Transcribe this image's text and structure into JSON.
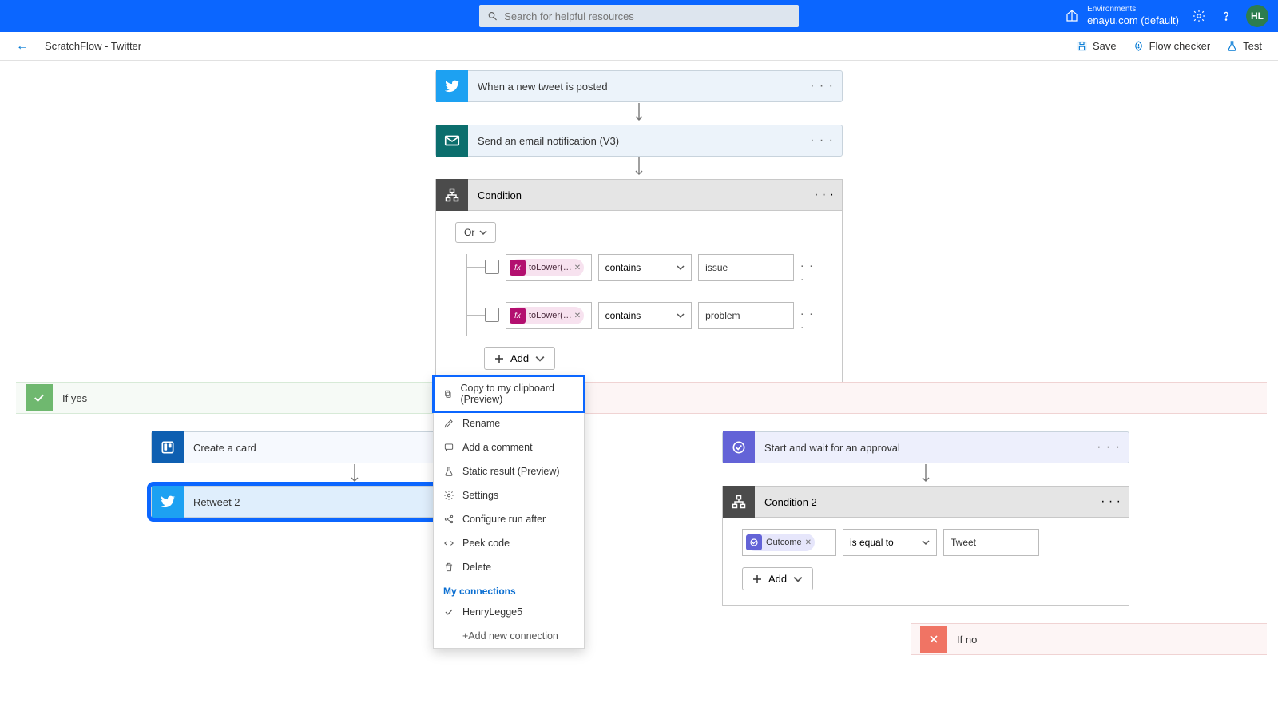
{
  "header": {
    "search_placeholder": "Search for helpful resources",
    "env_label": "Environments",
    "env_value": "enayu.com (default)",
    "avatar_initials": "HL"
  },
  "secbar": {
    "title": "ScratchFlow - Twitter",
    "save": "Save",
    "checker": "Flow checker",
    "test": "Test"
  },
  "steps": {
    "trigger": "When a new tweet is posted",
    "email": "Send an email notification (V3)",
    "condition": "Condition",
    "or_label": "Or",
    "rows": [
      {
        "token": "toLower(…",
        "op": "contains",
        "val": "issue"
      },
      {
        "token": "toLower(…",
        "op": "contains",
        "val": "problem"
      }
    ],
    "add": "Add"
  },
  "branches": {
    "yes": "If yes",
    "no": "If no",
    "no2": "If no",
    "create_card": "Create a card",
    "retweet": "Retweet 2",
    "approval": "Start and wait for an approval",
    "condition2": "Condition 2",
    "c2_token": "Outcome",
    "c2_op": "is equal to",
    "c2_val": "Tweet",
    "c2_add": "Add"
  },
  "ctx": {
    "copy": "Copy to my clipboard (Preview)",
    "rename": "Rename",
    "comment": "Add a comment",
    "static": "Static result (Preview)",
    "settings": "Settings",
    "runafter": "Configure run after",
    "peek": "Peek code",
    "delete": "Delete",
    "connections": "My connections",
    "conn1": "HenryLegge5",
    "addconn": "+Add new connection"
  }
}
